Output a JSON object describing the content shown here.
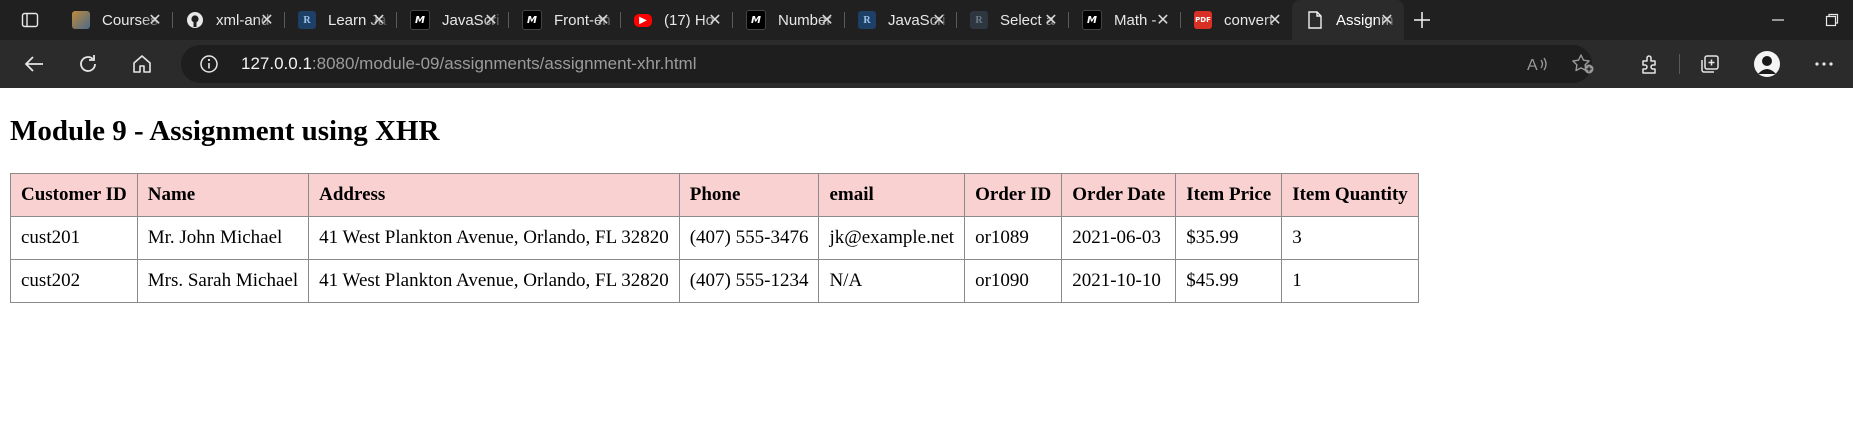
{
  "browser": {
    "tabs": [
      {
        "title": "Courses",
        "favicon": "courses-icon",
        "color": "#8a6a3a"
      },
      {
        "title": "xml-and",
        "favicon": "github-icon",
        "color": "#ffffff"
      },
      {
        "title": "Learn Ja",
        "favicon": "bookstack-icon",
        "color": "#2a5a8a"
      },
      {
        "title": "JavaScri",
        "favicon": "mdn-icon",
        "color": "#000000"
      },
      {
        "title": "Front-en",
        "favicon": "mdn-icon",
        "color": "#000000"
      },
      {
        "title": "(17) Ho",
        "favicon": "youtube-icon",
        "color": "#ff0000"
      },
      {
        "title": "Number",
        "favicon": "mdn-icon",
        "color": "#000000"
      },
      {
        "title": "JavaScri",
        "favicon": "bookstack-icon",
        "color": "#2a5a8a"
      },
      {
        "title": "Select a",
        "favicon": "bookstack-icon",
        "color": "#3a4a5a"
      },
      {
        "title": "Math -",
        "favicon": "mdn-icon",
        "color": "#000000"
      },
      {
        "title": "convert",
        "favicon": "pdf-icon",
        "color": "#d93025"
      },
      {
        "title": "Assignm",
        "favicon": "page-icon",
        "color": "#ffffff",
        "active": true
      }
    ],
    "address": {
      "host": "127.0.0.1",
      "rest": ":8080/module-09/assignments/assignment-xhr.html"
    },
    "accent": "#2b2b2b"
  },
  "page": {
    "heading": "Module 9 - Assignment using XHR",
    "table": {
      "header_color": "#f9d1d1",
      "columns": [
        "Customer ID",
        "Name",
        "Address",
        "Phone",
        "email",
        "Order ID",
        "Order Date",
        "Item Price",
        "Item Quantity"
      ],
      "rows": [
        [
          "cust201",
          "Mr. John Michael",
          "41 West Plankton Avenue, Orlando, FL 32820",
          "(407) 555-3476",
          "jk@example.net",
          "or1089",
          "2021-06-03",
          "$35.99",
          "3"
        ],
        [
          "cust202",
          "Mrs. Sarah Michael",
          "41 West Plankton Avenue, Orlando, FL 32820",
          "(407) 555-1234",
          "N/A",
          "or1090",
          "2021-10-10",
          "$45.99",
          "1"
        ]
      ]
    }
  }
}
